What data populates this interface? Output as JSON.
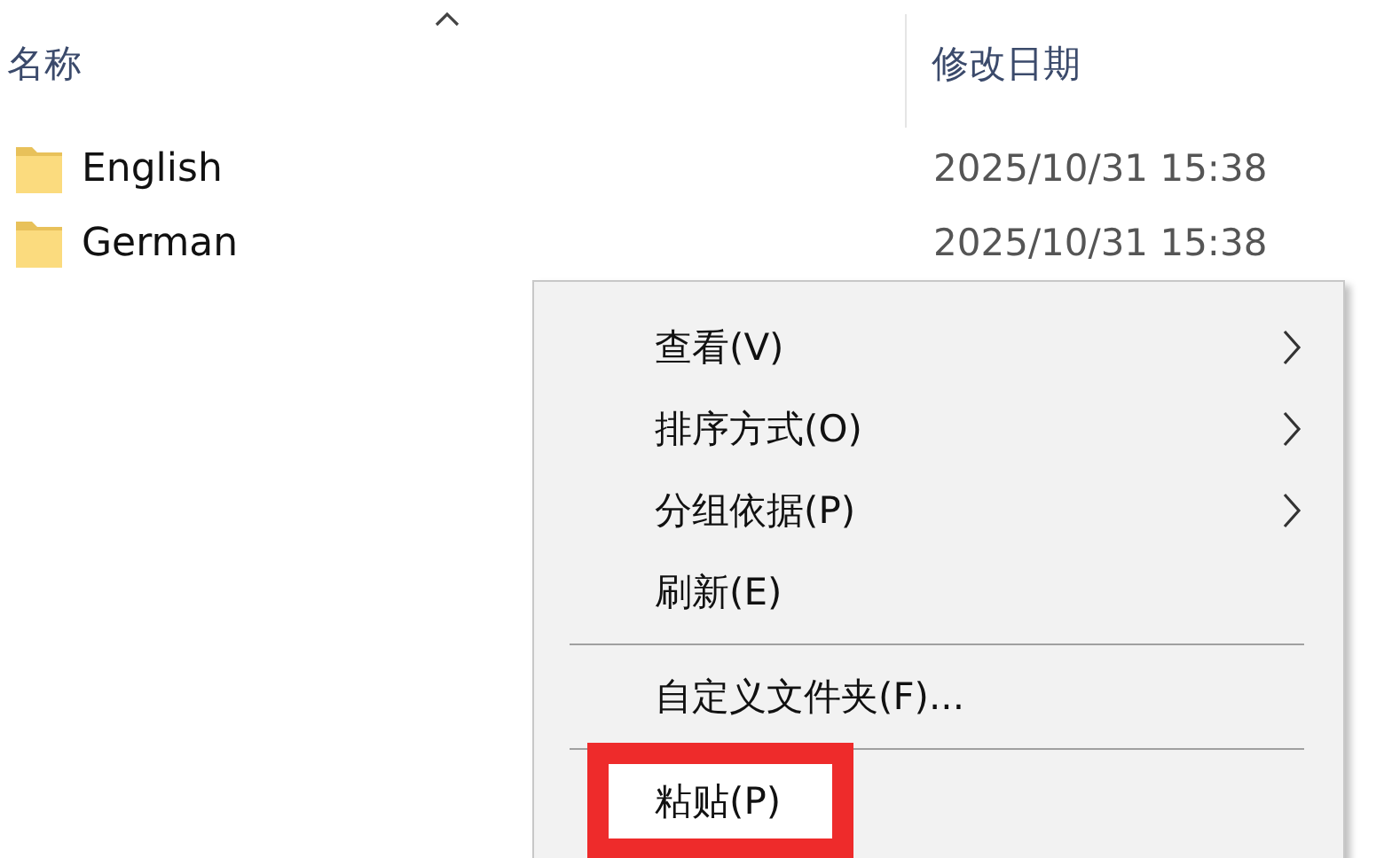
{
  "columns": [
    {
      "label": "名称",
      "sorted": true
    },
    {
      "label": "修改日期",
      "sorted": false
    }
  ],
  "files": [
    {
      "name": "English",
      "modified": "2025/10/31 15:38"
    },
    {
      "name": "German",
      "modified": "2025/10/31 15:38"
    }
  ],
  "context_menu": {
    "items": [
      {
        "kind": "item",
        "label": "查看(V)",
        "submenu": true,
        "highlighted": false
      },
      {
        "kind": "item",
        "label": "排序方式(O)",
        "submenu": true,
        "highlighted": false
      },
      {
        "kind": "item",
        "label": "分组依据(P)",
        "submenu": true,
        "highlighted": false
      },
      {
        "kind": "item",
        "label": "刷新(E)",
        "submenu": false,
        "highlighted": false
      },
      {
        "kind": "separator"
      },
      {
        "kind": "item",
        "label": "自定义文件夹(F)...",
        "submenu": false,
        "highlighted": false
      },
      {
        "kind": "separator"
      },
      {
        "kind": "item",
        "label": "粘贴(P)",
        "submenu": false,
        "highlighted": true
      }
    ]
  }
}
